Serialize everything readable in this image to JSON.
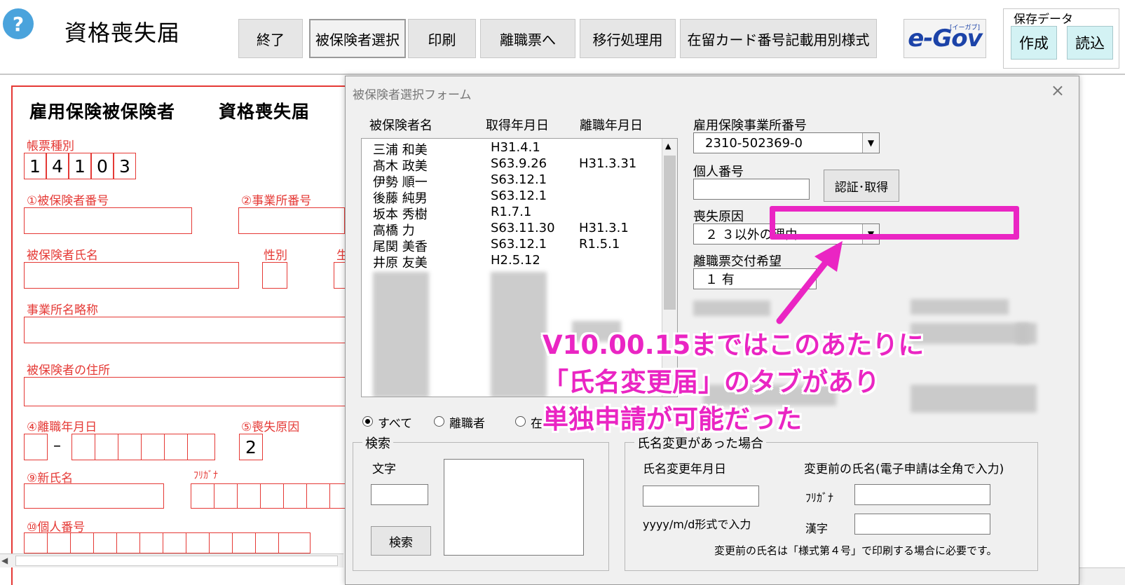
{
  "app": {
    "title": "資格喪失届",
    "help_icon": "?"
  },
  "toolbar": {
    "exit": "終了",
    "select_insured": "被保険者選択",
    "print": "印刷",
    "to_separation": "離職票へ",
    "migration": "移行処理用",
    "residence_card": "在留カード番号記載用別様式",
    "egov_logo": "e-Gov",
    "egov_sub": "[イーガブ]"
  },
  "save_group": {
    "label": "保存データ",
    "create": "作成",
    "load": "読込"
  },
  "form": {
    "title_a": "雇用保険被保険者",
    "title_b": "資格喪失届",
    "form_type_label": "帳票種別",
    "form_type_digits": [
      "1",
      "4",
      "1",
      "0",
      "3"
    ],
    "insured_number_label": "①被保険者番号",
    "office_number_label": "②事業所番号",
    "insured_name_label": "被保険者氏名",
    "gender_label": "性別",
    "birth_label_partial": "生",
    "office_short_name_label": "事業所名略称",
    "insured_address_label": "被保険者の住所",
    "separation_date_label": "④離職年月日",
    "separation_dash": "–",
    "loss_reason_label": "⑤喪失原因",
    "loss_reason_value": "2",
    "new_name_label": "⑨新氏名",
    "furigana_label": "ﾌﾘｶﾞﾅ",
    "personal_number_label": "⑩個人番号"
  },
  "dialog": {
    "title": "被保険者選択フォーム",
    "close": "×",
    "list_headers": {
      "name": "被保険者名",
      "acquired": "取得年月日",
      "separated": "離職年月日"
    },
    "rows": [
      {
        "name": "三浦 和美",
        "acquired": "H31.4.1",
        "separated": ""
      },
      {
        "name": "髙木 政美",
        "acquired": "S63.9.26",
        "separated": "H31.3.31"
      },
      {
        "name": "伊勢 順一",
        "acquired": "S63.12.1",
        "separated": ""
      },
      {
        "name": "後藤 純男",
        "acquired": "S63.12.1",
        "separated": ""
      },
      {
        "name": "坂本 秀樹",
        "acquired": "R1.7.1",
        "separated": ""
      },
      {
        "name": "高橋 力",
        "acquired": "S63.11.30",
        "separated": "H31.3.1"
      },
      {
        "name": "尾関 美香",
        "acquired": "S63.12.1",
        "separated": "R1.5.1"
      },
      {
        "name": "井原 友美",
        "acquired": "H2.5.12",
        "separated": ""
      }
    ],
    "office_number_label": "雇用保険事業所番号",
    "office_number_value": "2310-502369-0",
    "personal_number_label": "個人番号",
    "auth_button": "認証･取得",
    "loss_reason_label": "喪失原因",
    "loss_reason_value": "２ ３以外の理由",
    "separation_slip_label": "離職票交付希望",
    "separation_slip_value": "１ 有",
    "filter": {
      "all": "すべて",
      "separated": "離職者",
      "current_partial": "在"
    },
    "search": {
      "frame_label": "検索",
      "text_label": "文字",
      "button": "検索"
    },
    "name_change": {
      "frame_label": "氏名変更があった場合",
      "date_label": "氏名変更年月日",
      "date_hint": "yyyy/m/d形式で入力",
      "prev_name_label": "変更前の氏名(電子申請は全角で入力)",
      "furigana_label": "ﾌﾘｶﾞﾅ",
      "kanji_label": "漢字",
      "note": "変更前の氏名は「様式第４号」で印刷する場合に必要です。"
    }
  },
  "annotation": {
    "line1": "V10.00.15まではこのあたりに",
    "line2": "「氏名変更届」のタブがあり",
    "line3": "単独申請が可能だった",
    "color": "#ea25c3"
  },
  "colors": {
    "form_red": "#e53935",
    "save_button_bg": "#d3f2f4",
    "dialog_bg": "#f0f0f0",
    "help_blue": "#4aa3dc"
  }
}
